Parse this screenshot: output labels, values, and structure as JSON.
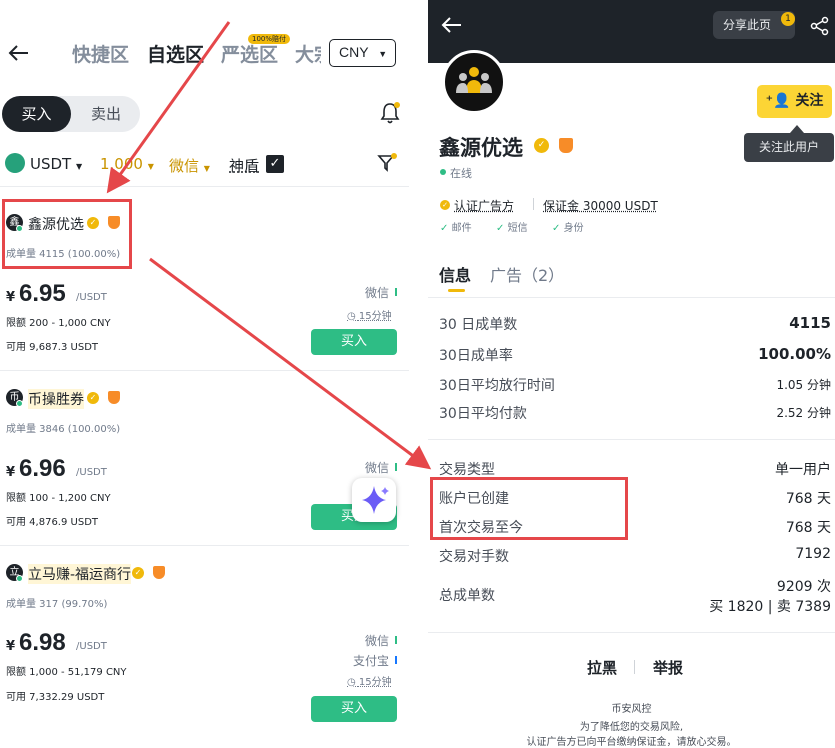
{
  "left": {
    "tabs": [
      "快捷区",
      "自选区",
      "严选区",
      "大宗"
    ],
    "badge": "100%赔付",
    "currency": "CNY",
    "segment": {
      "buy": "买入",
      "sell": "卖出"
    },
    "filters": {
      "coin": "USDT",
      "amount": "1,000",
      "payment": "微信",
      "shield": "神盾"
    },
    "listings": [
      {
        "merchant": "鑫源优选",
        "avatar_letter": "鑫",
        "orders": "成单量 4115 (100.00%)",
        "currency_symbol": "¥",
        "price": "6.95",
        "unit": "/USDT",
        "limit": "限额 200 - 1,000 CNY",
        "available": "可用 9,687.3 USDT",
        "payments": [
          "微信"
        ],
        "time": "15分钟",
        "button": "买入"
      },
      {
        "merchant": "币操胜券",
        "avatar_letter": "币",
        "orders": "成单量 3846 (100.00%)",
        "currency_symbol": "¥",
        "price": "6.96",
        "unit": "/USDT",
        "limit": "限额 100 - 1,200 CNY",
        "available": "可用 4,876.9 USDT",
        "payments": [
          "微信"
        ],
        "button": "买入"
      },
      {
        "merchant": "立马赚-福运商行",
        "avatar_letter": "立",
        "orders": "成单量 317 (99.70%)",
        "currency_symbol": "¥",
        "price": "6.98",
        "unit": "/USDT",
        "limit": "限额 1,000 - 51,179 CNY",
        "available": "可用 7,332.29 USDT",
        "payments": [
          "微信",
          "支付宝"
        ],
        "time": "15分钟",
        "button": "买入"
      }
    ]
  },
  "right": {
    "share": "分享此页",
    "share_count": "1",
    "follow": "关注",
    "tooltip": "关注此用户",
    "name": "鑫源优选",
    "status": "在线",
    "verified": "认证广告方",
    "deposit": "保证金 30000 USDT",
    "checks": [
      "邮件",
      "短信",
      "身份"
    ],
    "tabs": [
      "信息",
      "广告（2）"
    ],
    "stats": [
      {
        "label": "30 日成单数",
        "value": "4115",
        "bold": true
      },
      {
        "label": "30日成单率",
        "value": "100.00%",
        "bold": true
      },
      {
        "label": "30日平均放行时间",
        "value": "1.05 分钟"
      },
      {
        "label": "30日平均付款",
        "value": "2.52 分钟"
      }
    ],
    "details": [
      {
        "label": "交易类型",
        "value": "单一用户"
      },
      {
        "label": "账户已创建",
        "value": "768 天"
      },
      {
        "label": "首次交易至今",
        "value": "768 天"
      },
      {
        "label": "交易对手数",
        "value": "7192"
      }
    ],
    "total": {
      "label": "总成单数",
      "value": "9209 次",
      "sub": "买 1820 | 卖 7389"
    },
    "actions": {
      "block": "拉黑",
      "report": "举报"
    },
    "footer": {
      "title": "币安风控",
      "line1": "为了降低您的交易风险,",
      "line2": "认证广告方已向平台缴纳保证金，请放心交易。"
    }
  },
  "colors": {
    "accent": "#f0b90b",
    "buy": "#2ebd85",
    "annotation": "#e5474a"
  }
}
